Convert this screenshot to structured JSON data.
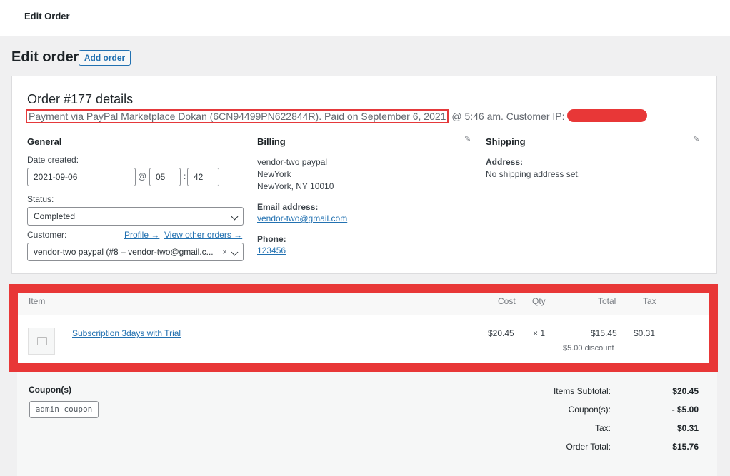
{
  "topbar": {
    "title": "Edit Order"
  },
  "page": {
    "heading": "Edit order",
    "add_button": "Add order"
  },
  "order": {
    "title": "Order #177 details",
    "payment_text": "Payment via PayPal Marketplace Dokan (6CN94499PN622844R). Paid on September 6, 2021",
    "payment_suffix": "@ 5:46 am. Customer IP:"
  },
  "general": {
    "heading": "General",
    "date_label": "Date created:",
    "date_value": "2021-09-06",
    "at_sep": "@",
    "hour": "05",
    "colon": ":",
    "minute": "42",
    "status_label": "Status:",
    "status_value": "Completed",
    "customer_label": "Customer:",
    "profile_link": "Profile →",
    "other_orders_link": "View other orders →",
    "customer_value": "vendor-two paypal (#8 – vendor-two@gmail.c...",
    "clear_symbol": "×"
  },
  "billing": {
    "heading": "Billing",
    "address_lines": [
      "vendor-two paypal",
      "NewYork",
      "NewYork, NY 10010"
    ],
    "email_label": "Email address:",
    "email": "vendor-two@gmail.com",
    "phone_label": "Phone:",
    "phone": "123456"
  },
  "shipping": {
    "heading": "Shipping",
    "address_label": "Address:",
    "address_value": "No shipping address set."
  },
  "items": {
    "headers": {
      "item": "Item",
      "cost": "Cost",
      "qty": "Qty",
      "total": "Total",
      "tax": "Tax"
    },
    "rows": [
      {
        "name": "Subscription 3days with Trial",
        "cost": "$20.45",
        "qty": "× 1",
        "total": "$15.45",
        "discount": "$5.00 discount",
        "tax": "$0.31"
      }
    ]
  },
  "totals": {
    "coupon_heading": "Coupon(s)",
    "coupon_code": "admin coupon",
    "lines": [
      {
        "label": "Items Subtotal:",
        "value": "$20.45"
      },
      {
        "label": "Coupon(s):",
        "value": "- $5.00"
      },
      {
        "label": "Tax:",
        "value": "$0.31"
      },
      {
        "label": "Order Total:",
        "value": "$15.76"
      }
    ]
  },
  "colors": {
    "accent": "#2271b1",
    "highlight": "#e83737"
  },
  "icons": {
    "edit": "pencil-icon",
    "dropdown": "chevron-down-icon",
    "placeholder": "image-placeholder-icon"
  }
}
